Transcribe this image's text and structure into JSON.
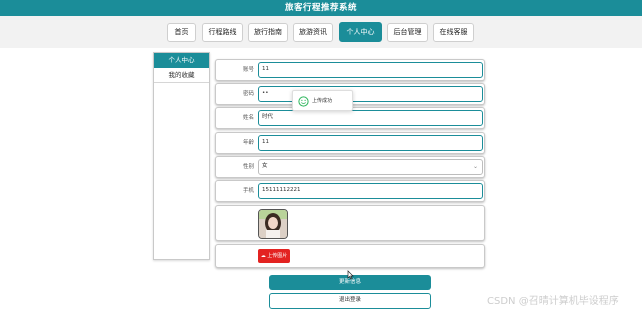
{
  "header": {
    "title": "旅客行程推荐系统"
  },
  "nav": {
    "items": [
      {
        "label": "首页",
        "active": false
      },
      {
        "label": "行程路线",
        "active": false
      },
      {
        "label": "旅行指南",
        "active": false
      },
      {
        "label": "旅游资讯",
        "active": false
      },
      {
        "label": "个人中心",
        "active": true
      },
      {
        "label": "后台管理",
        "active": false
      },
      {
        "label": "在线客服",
        "active": false
      }
    ]
  },
  "sidebar": {
    "items": [
      {
        "label": "个人中心",
        "active": true
      },
      {
        "label": "我的收藏",
        "active": false
      }
    ]
  },
  "form": {
    "account": {
      "label": "账号",
      "value": "11"
    },
    "password": {
      "label": "密码",
      "value": "••"
    },
    "name": {
      "label": "姓名",
      "value": "时代"
    },
    "age": {
      "label": "年龄",
      "value": "11"
    },
    "gender": {
      "label": "性别",
      "value": "女"
    },
    "phone": {
      "label": "手机",
      "value": "15111112221"
    },
    "upload_label": "上传图片"
  },
  "toast": {
    "text": "上传成功"
  },
  "actions": {
    "update_label": "更新信息",
    "logout_label": "退出登录"
  },
  "watermark": "CSDN @召晴计算机毕设程序",
  "colors": {
    "primary": "#1b8d99",
    "upload": "#e32321",
    "success": "#2bb55a"
  },
  "icons": {
    "toast": "smile-icon",
    "upload": "cloud-upload-icon",
    "select": "chevron-down-icon"
  }
}
